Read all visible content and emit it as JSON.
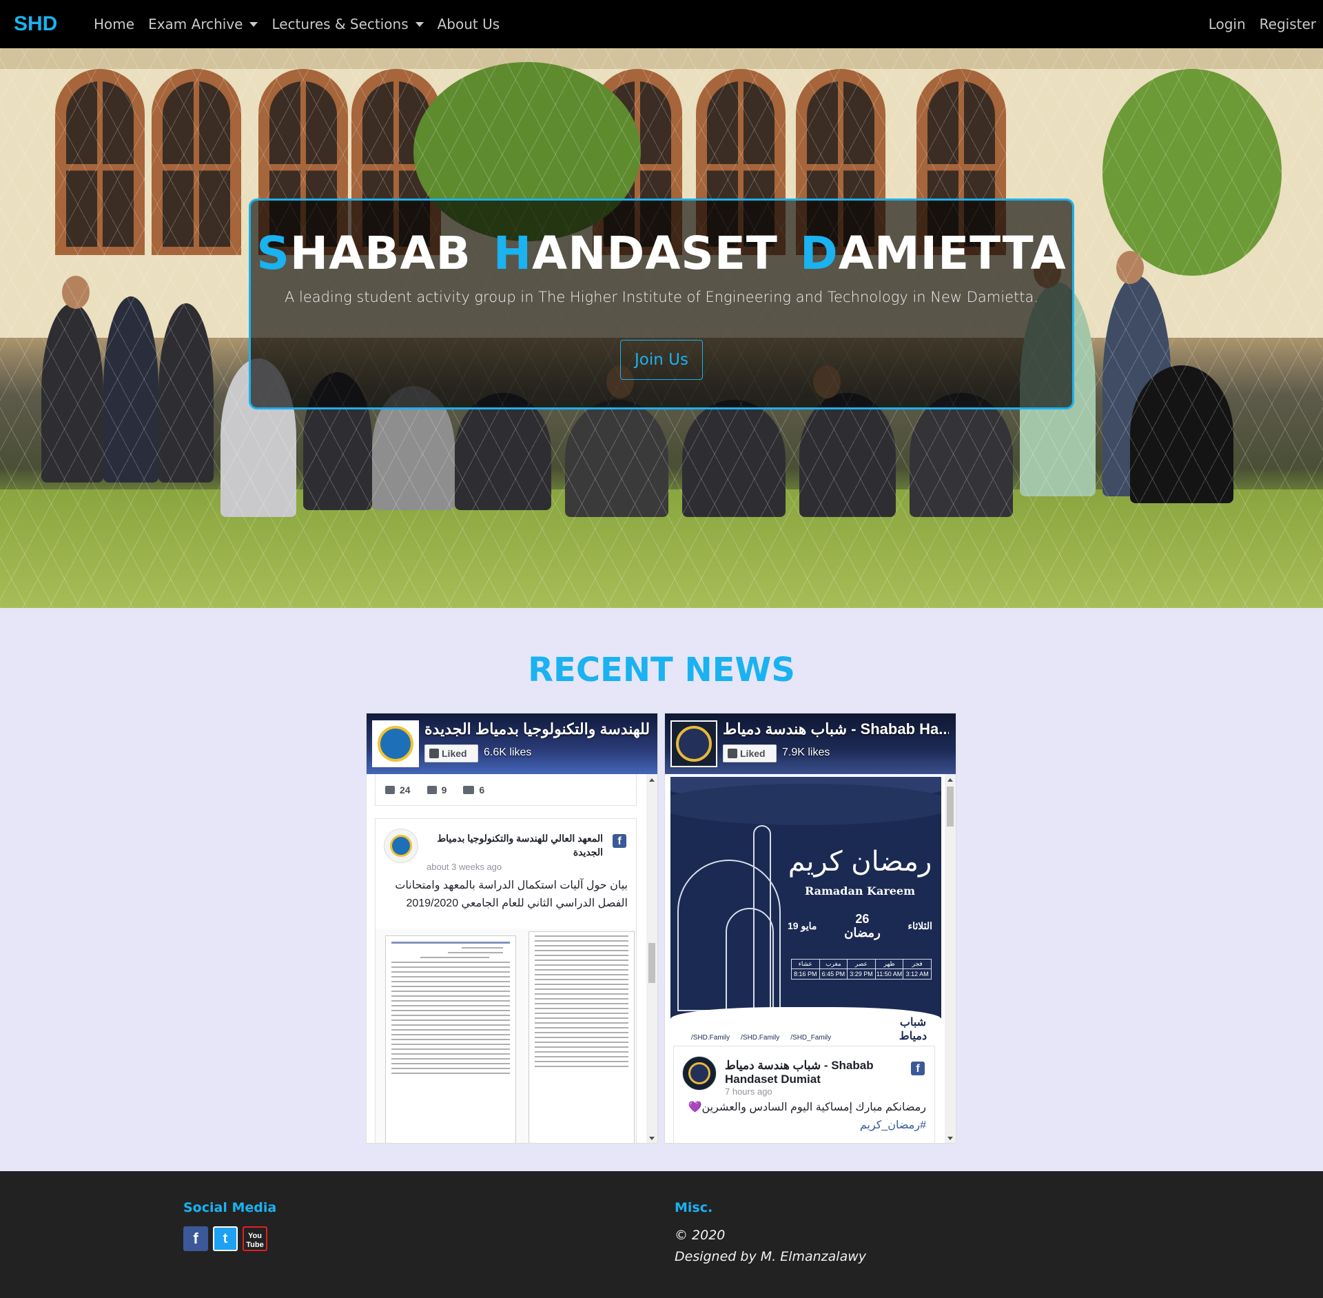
{
  "navbar": {
    "brand": "SHD",
    "links": [
      {
        "label": "Home",
        "dropdown": false
      },
      {
        "label": "Exam Archive",
        "dropdown": true
      },
      {
        "label": "Lectures & Sections",
        "dropdown": true
      },
      {
        "label": "About Us",
        "dropdown": false
      }
    ],
    "auth": {
      "login": "Login",
      "register": "Register"
    }
  },
  "hero": {
    "title_words": [
      {
        "first": "S",
        "rest": "HABAB"
      },
      {
        "first": "H",
        "rest": "ANDASET"
      },
      {
        "first": "D",
        "rest": "AMIETTA"
      }
    ],
    "subtitle": "A leading student activity group in The Higher Institute of Engineering and Technology in New Damietta.",
    "cta": "Join Us"
  },
  "news": {
    "heading": "RECENT NEWS",
    "feeds": [
      {
        "page_name": "لي للهندسة والتكنولوجيا بدمياط الجديدة...",
        "liked_label": "Liked",
        "likes": "6.6K likes",
        "reactions": {
          "likes": "24",
          "comments": "9",
          "shares": "6"
        },
        "post": {
          "author": "المعهد العالي للهندسة والتكنولوجيا بدمياط الجديدة",
          "time": "about 3 weeks ago",
          "text": "بيان حول آليات استكمال الدراسة بالمعهد وامتحانات الفصل الدراسي الثاني للعام الجامعي 2019/2020"
        }
      },
      {
        "page_name": "شباب هندسة دمياط - Shabab Ha...",
        "liked_label": "Liked",
        "likes": "7.9K likes",
        "image": {
          "title_ar": "رمضان كريم",
          "title_en": "Ramadan Kareem",
          "day": "الثلاثاء",
          "hijri_day": "26",
          "hijri_month": "رمضان",
          "greg_date": "19 مايو",
          "prayers": [
            {
              "name": "عشاء",
              "time": "8:16 PM"
            },
            {
              "name": "مغرب",
              "time": "6:45 PM"
            },
            {
              "name": "عصر",
              "time": "3:29 PM"
            },
            {
              "name": "ظهر",
              "time": "11:50 AM"
            },
            {
              "name": "فجر",
              "time": "3:12 AM"
            }
          ],
          "handles": [
            "/SHD.Family",
            "/SHD.Family",
            "/SHD_Family"
          ],
          "logo_text": "شباب دمياط"
        },
        "post": {
          "author": "شباب هندسة دمياط - Shabab Handaset Dumiat",
          "time": "7 hours ago",
          "text": "رمضانكم مبارك إمساكية اليوم السادس والعشرين💜",
          "hashtag": "#رمضان_كريم"
        }
      }
    ]
  },
  "footer": {
    "social_title": "Social Media",
    "social_icons": [
      "facebook-icon",
      "twitter-icon",
      "youtube-icon"
    ],
    "misc_title": "Misc.",
    "copyright": "© 2020",
    "credit": "Designed by M. Elmanzalawy"
  },
  "colors": {
    "accent": "#1ab2f0",
    "navbar": "#000000",
    "page_bg": "#e6e6f8",
    "footer": "#222222"
  }
}
